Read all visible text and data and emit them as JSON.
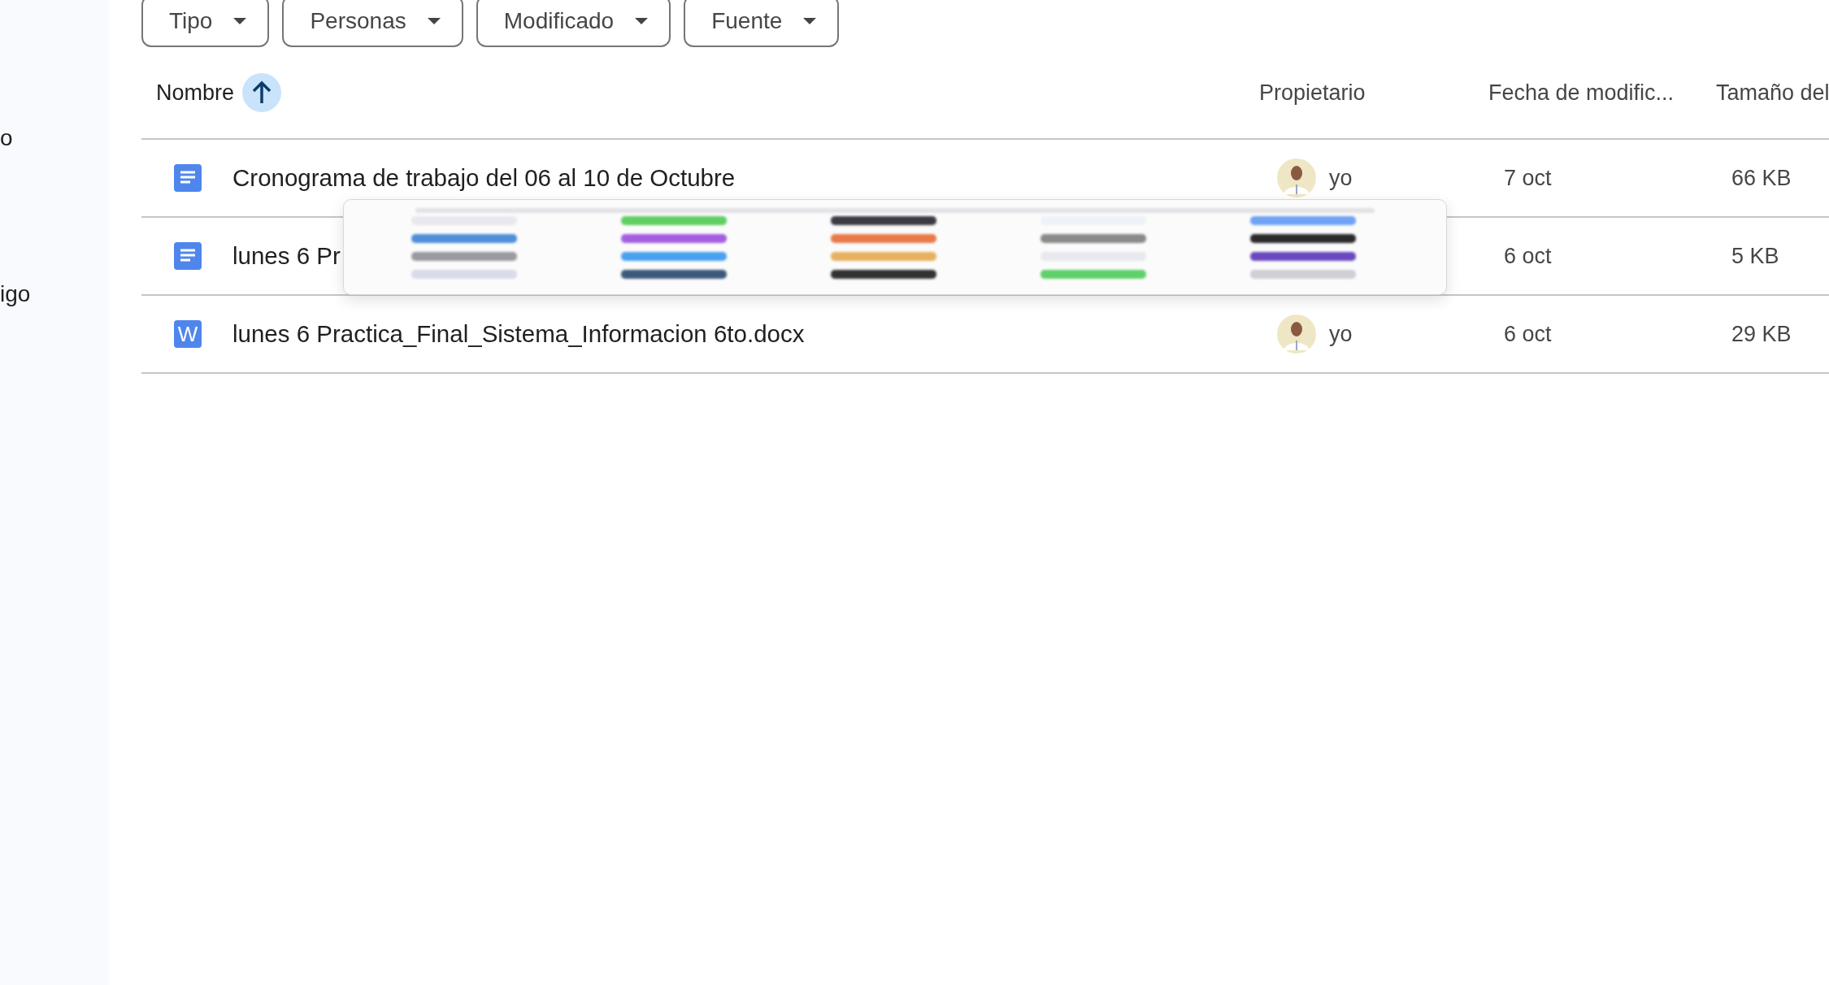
{
  "sidebar": {
    "items": [
      {
        "label": "o"
      },
      {
        "label": "igo"
      }
    ]
  },
  "filters": [
    {
      "label": "Tipo"
    },
    {
      "label": "Personas"
    },
    {
      "label": "Modificado"
    },
    {
      "label": "Fuente"
    }
  ],
  "table": {
    "columns": [
      {
        "label": "Nombre",
        "sorted": true
      },
      {
        "label": "Propietario",
        "sorted": false
      },
      {
        "label": "Fecha de modific...",
        "sorted": false
      },
      {
        "label": "Tamaño del",
        "sorted": false
      }
    ],
    "rows": [
      {
        "kind": "doc",
        "name": "Cronograma de trabajo del 06 al 10 de Octubre",
        "owner": "yo",
        "date": "7 oct",
        "size": "66 KB"
      },
      {
        "kind": "doc",
        "name": "lunes 6 Pr",
        "date": "6 oct",
        "size": "5 KB"
      },
      {
        "kind": "word",
        "icon_letter": "W",
        "name": "lunes 6 Practica_Final_Sistema_Informacion 6to.docx",
        "owner": "yo",
        "date": "6 oct",
        "size": "29 KB"
      }
    ]
  },
  "overlay": {
    "kind": "app-launcher"
  }
}
